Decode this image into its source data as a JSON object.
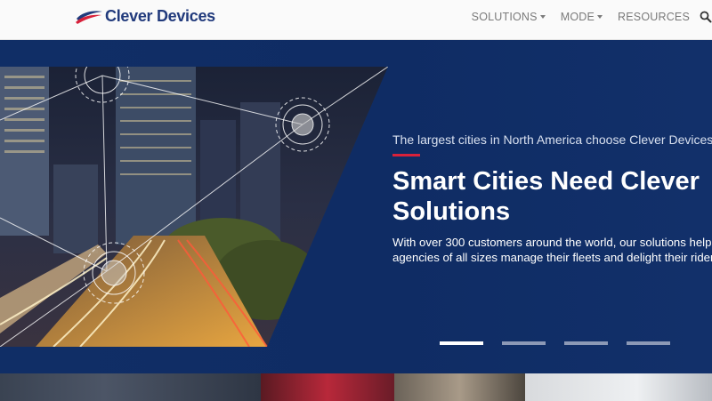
{
  "brand": {
    "name": "Clever Devices",
    "colors": {
      "navy": "#213a7c",
      "red": "#d8213a"
    }
  },
  "nav": {
    "items": [
      {
        "label": "SOLUTIONS",
        "has_dropdown": true
      },
      {
        "label": "MODE",
        "has_dropdown": true
      },
      {
        "label": "RESOURCES",
        "has_dropdown": false
      }
    ],
    "search_icon": "search-icon"
  },
  "hero": {
    "eyebrow": "The largest cities in North America choose Clever Devices",
    "title": "Smart Cities Need Clever Solutions",
    "body_line1": "With over 300 customers around the world, our solutions help",
    "body_line2": "agencies of all sizes manage their fleets and delight their riders",
    "background_color": "#0f2c64",
    "accent_color": "#d8213a"
  },
  "carousel": {
    "slide_count": 4,
    "active_index": 0
  },
  "strip": {
    "tiles": [
      "road-photo",
      "red-bus-photo",
      "bus-interior-photo",
      "ceiling-photo"
    ]
  }
}
